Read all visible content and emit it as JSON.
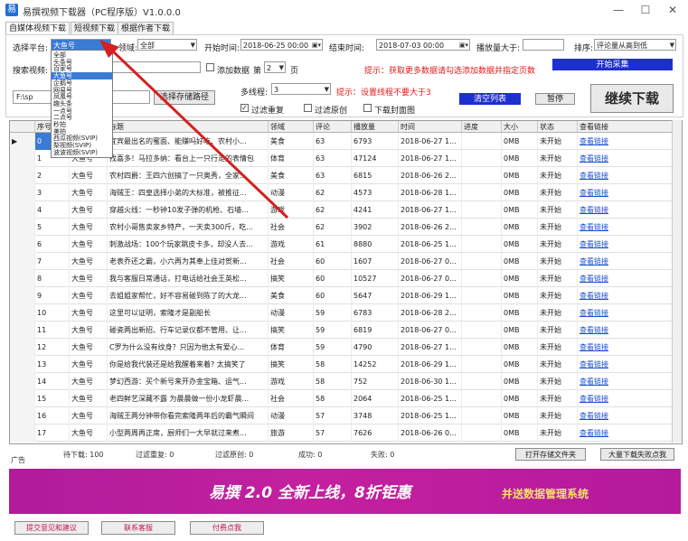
{
  "window": {
    "title": "易撰视频下载器（PC程序版）V1.0.0.0",
    "minimize": "—",
    "maximize": "☐",
    "close": "✕"
  },
  "tabs": [
    "自媒体视频下载",
    "短视频下载",
    "根据作者下载"
  ],
  "filters": {
    "platform_label": "选择平台:",
    "platform_value": "大鱼号",
    "domain_label": "领域:",
    "domain_value": "全部",
    "start_label": "开始时间:",
    "start_value": "2018-06-25 00:00",
    "end_label": "结束时间:",
    "end_value": "2018-07-03 00:00",
    "plays_label": "播放量大于:",
    "plays_value": "",
    "sort_label": "排序:",
    "sort_value": "评论量从高到低",
    "search_label": "搜索视频:",
    "search_value": "",
    "add_pages_label": "添加数据",
    "page_prefix": "第",
    "page_value": "2",
    "page_suffix": "页",
    "tip_pages": "提示：获取更多数据请勾选添加数据并指定页数",
    "start_collect": "开始采集"
  },
  "dropdown_items": [
    "全部",
    "头条号",
    "百家号",
    "大鱼号",
    "企鹅号",
    "网易号",
    "凤凰号",
    "趣头条",
    "一点号",
    "二点号",
    "秒拍",
    "美拍",
    "西瓜视频(SVIP)",
    "梨视频(SVIP)",
    "波波视频(SVIP)"
  ],
  "dropdown_selected": "大鱼号",
  "path": {
    "value": "F:\\sp",
    "choose_button": "选择存储路径"
  },
  "threads": {
    "label": "多线程:",
    "value": "3",
    "tip": "提示：设置线程不要大于3"
  },
  "checks": {
    "filter_dup": "过滤重复",
    "filter_original": "过滤原创",
    "download_cover": "下载封面图"
  },
  "buttons": {
    "clear": "清空列表",
    "pause": "暂停",
    "resume": "继续下载"
  },
  "table": {
    "headers": [
      "序号",
      "平台",
      "标题",
      "领域",
      "评论",
      "播放量",
      "时间",
      "进度",
      "大小",
      "状态",
      "查看链接"
    ],
    "rows": [
      [
        "0",
        "大鱼号",
        "宜宾最出名的蜜面、能赚吗好吃、农村小...",
        "美食",
        "63",
        "6793",
        "2018-06-27 1...",
        "",
        "0MB",
        "未开始",
        "查看链接"
      ],
      [
        "1",
        "大鱼号",
        "找喜多！马拉多纳：看台上一只行走的表情包",
        "体育",
        "63",
        "47124",
        "2018-06-27 1...",
        "",
        "0MB",
        "未开始",
        "查看链接"
      ],
      [
        "2",
        "大鱼号",
        "农村四爵：王四六创搞了一只奥秀，全家...",
        "美食",
        "63",
        "6815",
        "2018-06-26 2...",
        "",
        "0MB",
        "未开始",
        "查看链接"
      ],
      [
        "3",
        "大鱼号",
        "海贼王：四皇选择小弟的大标准，被推征...",
        "动漫",
        "62",
        "4573",
        "2018-06-28 1...",
        "",
        "0MB",
        "未开始",
        "查看链接"
      ],
      [
        "4",
        "大鱼号",
        "穿越火线：一秒钟10发子弹的机枪、石墙...",
        "游戏",
        "62",
        "4241",
        "2018-06-27 1...",
        "",
        "0MB",
        "未开始",
        "查看链接"
      ],
      [
        "5",
        "大鱼号",
        "农村小哥售卖家乡特产，一天卖300斤，吃...",
        "社会",
        "62",
        "3902",
        "2018-06-26 2...",
        "",
        "0MB",
        "未开始",
        "查看链接"
      ],
      [
        "6",
        "大鱼号",
        "刺激战场：100个玩家跳皮卡多，却没人去...",
        "游戏",
        "61",
        "8880",
        "2018-06-25 1...",
        "",
        "0MB",
        "未开始",
        "查看链接"
      ],
      [
        "7",
        "大鱼号",
        "老表乔还之霸，小六再为其奉上佳对贺新...",
        "社会",
        "60",
        "1607",
        "2018-06-27 0...",
        "",
        "0MB",
        "未开始",
        "查看链接"
      ],
      [
        "8",
        "大鱼号",
        "我与客服日常通话，打电话给社会王英松...",
        "搞笑",
        "60",
        "10527",
        "2018-06-27 0...",
        "",
        "0MB",
        "未开始",
        "查看链接"
      ],
      [
        "9",
        "大鱼号",
        "去姐姐家帮忙，好不容易碰到陈了的大龙...",
        "美食",
        "60",
        "5647",
        "2018-06-29 1...",
        "",
        "0MB",
        "未开始",
        "查看链接"
      ],
      [
        "10",
        "大鱼号",
        "这里可以证明，索隆才是副船长",
        "动漫",
        "59",
        "6783",
        "2018-06-28 2...",
        "",
        "0MB",
        "未开始",
        "查看链接"
      ],
      [
        "11",
        "大鱼号",
        "碰瓷两出新招、行车记录仪都不管用、让...",
        "搞笑",
        "59",
        "6819",
        "2018-06-27 0...",
        "",
        "0MB",
        "未开始",
        "查看链接"
      ],
      [
        "12",
        "大鱼号",
        "C罗为什么没有纹身？只因为他太有爱心...",
        "体育",
        "59",
        "4790",
        "2018-06-27 1...",
        "",
        "0MB",
        "未开始",
        "查看链接"
      ],
      [
        "13",
        "大鱼号",
        "你是给我代装还是给我醒着来着? 太搞笑了",
        "搞笑",
        "58",
        "14252",
        "2018-06-29 1...",
        "",
        "0MB",
        "未开始",
        "查看链接"
      ],
      [
        "14",
        "大鱼号",
        "梦幻西游：买个新号来开办金宝箱、运气...",
        "游戏",
        "58",
        "752",
        "2018-06-30 1...",
        "",
        "0MB",
        "未开始",
        "查看链接"
      ],
      [
        "15",
        "大鱼号",
        "老四鲜艺深藏不露 为晨晨做一份小龙虾晨...",
        "社会",
        "58",
        "2064",
        "2018-06-25 1...",
        "",
        "0MB",
        "未开始",
        "查看链接"
      ],
      [
        "16",
        "大鱼号",
        "海贼王两分钟带你看完索隆两年后的霸气瞬间",
        "动漫",
        "57",
        "3748",
        "2018-06-25 1...",
        "",
        "0MB",
        "未开始",
        "查看链接"
      ],
      [
        "17",
        "大鱼号",
        "小型两周再正席，厨师们一大早就过来煮...",
        "旅游",
        "57",
        "7626",
        "2018-06-26 0...",
        "",
        "0MB",
        "未开始",
        "查看链接"
      ]
    ]
  },
  "status": {
    "ad_label": "广告",
    "pending": "待下载: 100",
    "dup": "过滤重复: 0",
    "original": "过滤原创: 0",
    "success": "成功: 0",
    "fail": "失败: 0",
    "open_folder": "打开存储文件夹",
    "bulk_download": "大量下载失败点我"
  },
  "banner": {
    "main": "易撰 2.0 全新上线，8折钜惠",
    "sub": "并送数据管理系统"
  },
  "bottom": {
    "feedback": "提交意见和建议",
    "contact": "联系客服",
    "pay": "付费点我"
  },
  "colors": {
    "accent_blue": "#1e2fd0",
    "banner_magenta": "#b8199c",
    "tip_red": "#e01b1b",
    "arrow_red": "#d42020"
  }
}
